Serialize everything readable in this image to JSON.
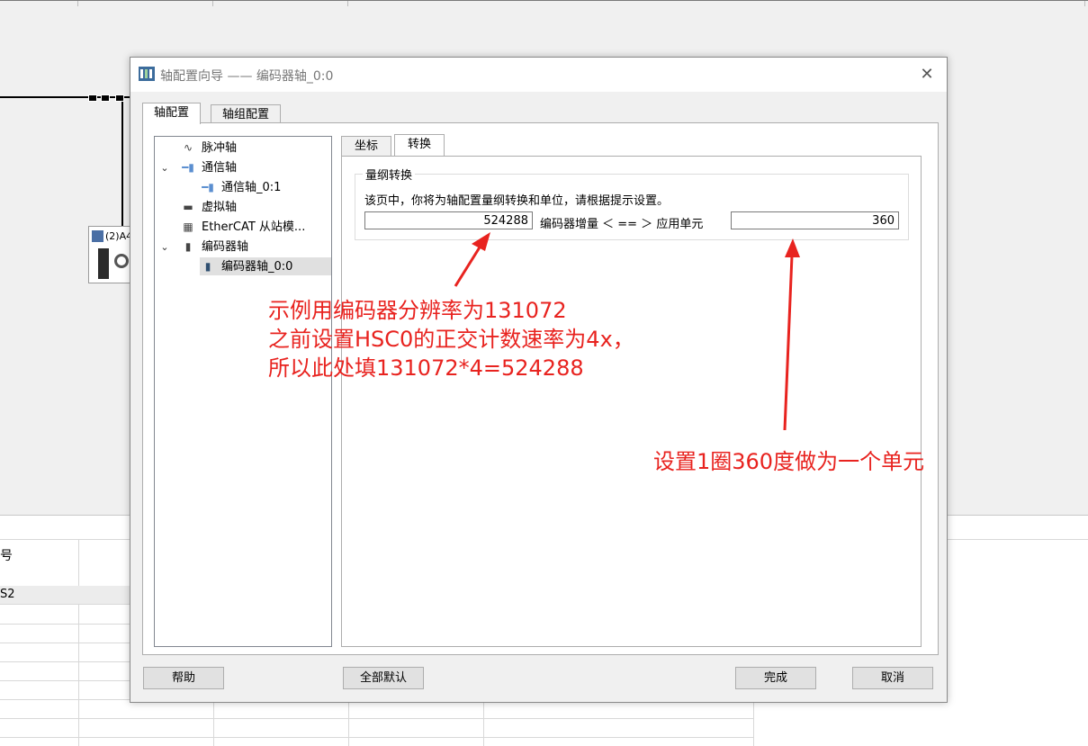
{
  "background": {
    "table_header": "号",
    "table_cell": "S2",
    "device_label": "(2)A4"
  },
  "dialog": {
    "title": "轴配置向导 —— 编码器轴_0:0",
    "close_symbol": "✕",
    "tabs": [
      {
        "label": "轴配置",
        "active": true
      },
      {
        "label": "轴组配置",
        "active": false
      }
    ],
    "tree": [
      {
        "label": "脉冲轴",
        "icon": "pulse-icon",
        "level": 0,
        "expanded": null
      },
      {
        "label": "通信轴",
        "icon": "comm-icon",
        "level": 0,
        "expanded": true
      },
      {
        "label": "通信轴_0:1",
        "icon": "comm-axis-icon",
        "level": 1
      },
      {
        "label": "虚拟轴",
        "icon": "virtual-icon",
        "level": 0
      },
      {
        "label": "EtherCAT 从站模...",
        "icon": "ethercat-icon",
        "level": 0
      },
      {
        "label": "编码器轴",
        "icon": "encoder-icon",
        "level": 0,
        "expanded": true
      },
      {
        "label": "编码器轴_0:0",
        "icon": "encoder-axis-icon",
        "level": 1,
        "selected": true
      }
    ],
    "sub_tabs": [
      {
        "label": "坐标",
        "active": false
      },
      {
        "label": "转换",
        "active": true
      }
    ],
    "conversion": {
      "group_title": "量纲转换",
      "description": "该页中，你将为轴配置量纲转换和单位，请根据提示设置。",
      "encoder_increment_value": "524288",
      "encoder_increment_label": "编码器增量 ＜ == ＞ 应用单元",
      "app_unit_value": "360"
    },
    "buttons": {
      "help": "帮助",
      "defaults": "全部默认",
      "finish": "完成",
      "cancel": "取消"
    }
  },
  "annotations": {
    "note1_line1": "示例用编码器分辨率为131072",
    "note1_line2": "之前设置HSC0的正交计数速率为4x，",
    "note1_line3": "所以此处填131072*4=524288",
    "note2": "设置1圈360度做为一个单元",
    "color": "#e8231f"
  }
}
